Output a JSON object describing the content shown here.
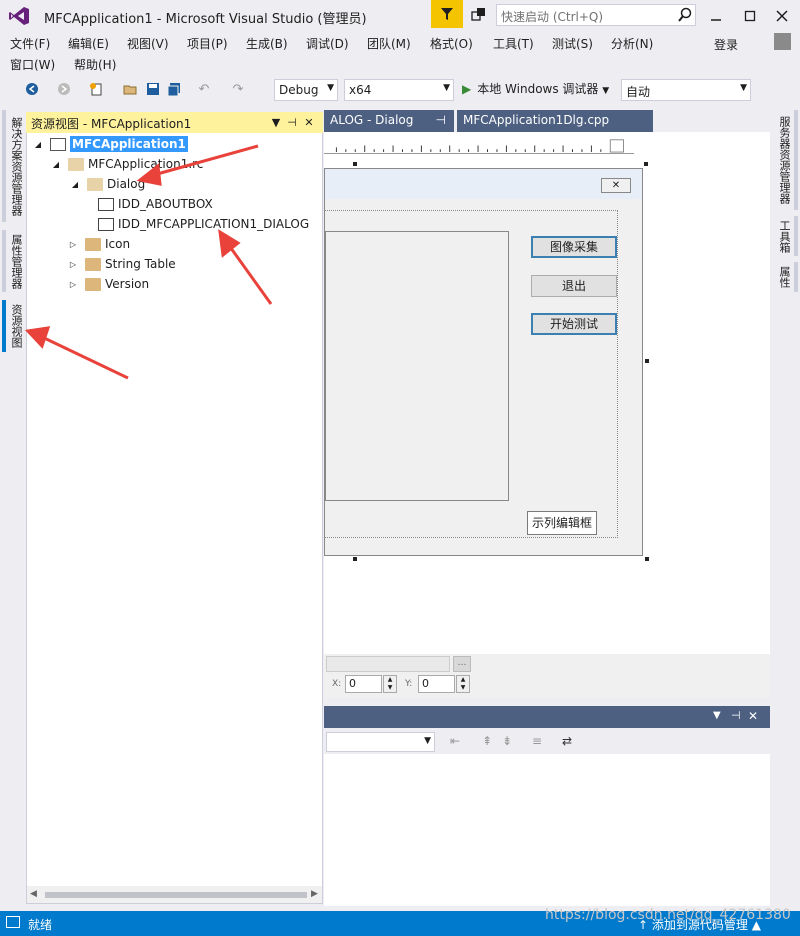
{
  "window": {
    "title": "MFCApplication1 - Microsoft Visual Studio (管理员)",
    "quick_launch_placeholder": "快速启动 (Ctrl+Q)",
    "sign_in": "登录"
  },
  "menu": {
    "row1": [
      "文件(F)",
      "编辑(E)",
      "视图(V)",
      "项目(P)",
      "生成(B)",
      "调试(D)",
      "团队(M)",
      "格式(O)",
      "工具(T)",
      "测试(S)",
      "分析(N)"
    ],
    "row2": [
      "窗口(W)",
      "帮助(H)"
    ]
  },
  "toolbar": {
    "config": "Debug",
    "platform": "x64",
    "run_label": "本地 Windows 调试器",
    "run_mode": "自动"
  },
  "left_tabs": [
    "解决方案资源管理器",
    "属性管理器",
    "资源视图"
  ],
  "right_tabs": [
    "服务器资源管理器",
    "工具箱",
    "属性"
  ],
  "resource_view": {
    "title": "资源视图 - MFCApplication1",
    "tree": {
      "root": "MFCApplication1",
      "rc_file": "MFCApplication1.rc",
      "dialog_folder": "Dialog",
      "dialogs": [
        "IDD_ABOUTBOX",
        "IDD_MFCAPPLICATION1_DIALOG"
      ],
      "other_folders": [
        "Icon",
        "String Table",
        "Version"
      ]
    }
  },
  "editor": {
    "tabs": [
      "ALOG - Dialog",
      "MFCApplication1Dlg.cpp"
    ],
    "dialog": {
      "buttons": [
        "图像采集",
        "退出",
        "开始测试"
      ],
      "edit_box": "示列编辑框"
    },
    "coords": {
      "x_label": "X:",
      "x_value": "0",
      "y_label": "Y:",
      "y_value": "0"
    }
  },
  "status": {
    "left": "就绪",
    "right": "添加到源代码管理"
  },
  "watermark": "https://blog.csdn.net/qq_42761380",
  "colors": {
    "accent": "#007acc",
    "tool_window_active_header": "#fff29d",
    "doc_tab": "#4d6082",
    "annotation_arrow": "#e8423a"
  }
}
